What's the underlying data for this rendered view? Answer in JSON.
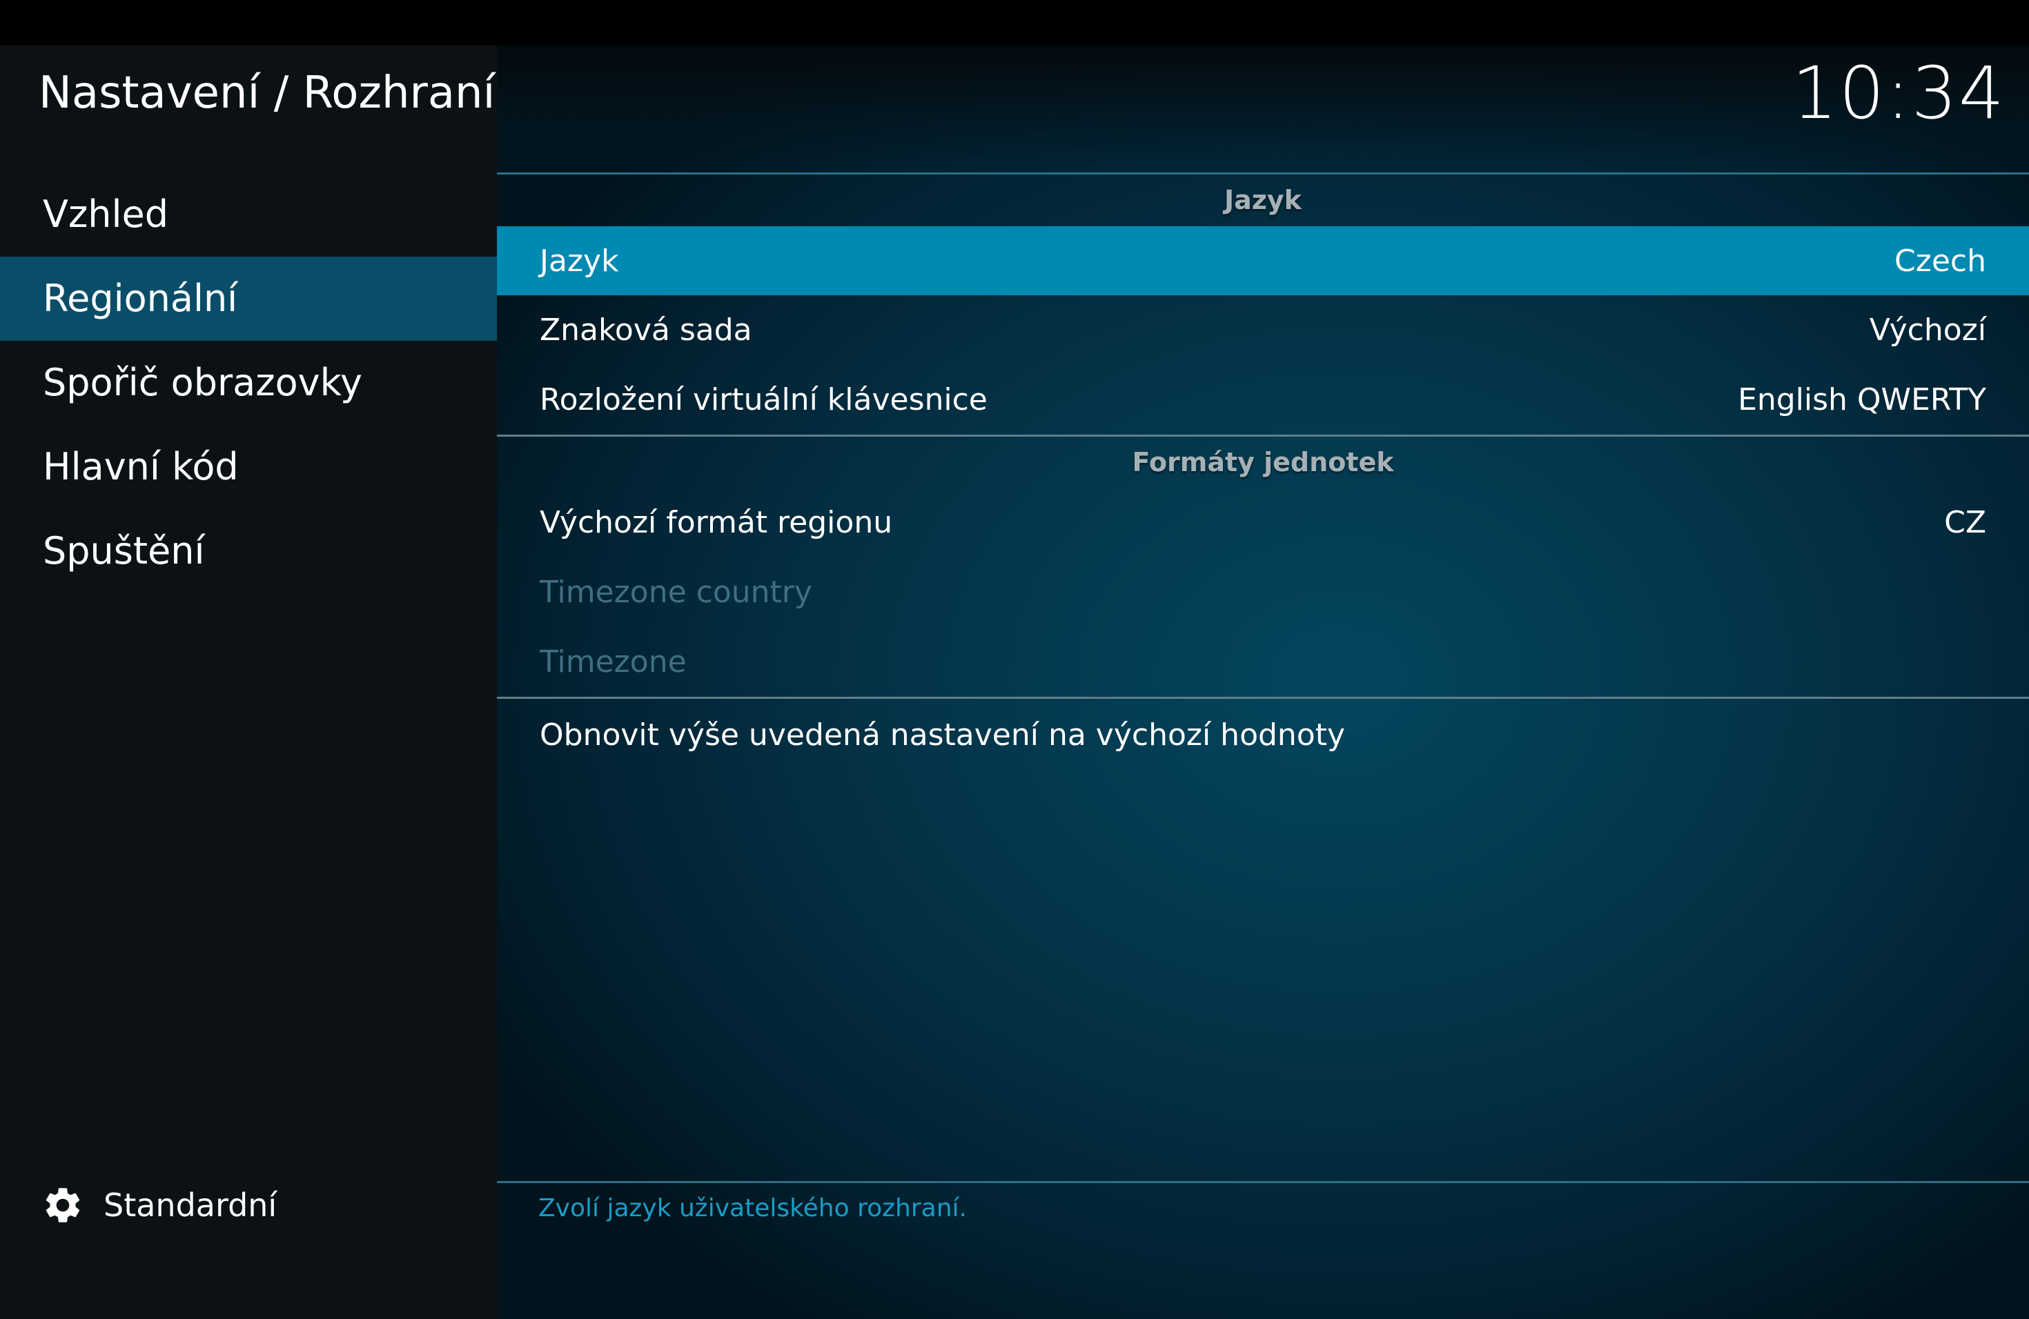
{
  "header": {
    "title": "Nastavení / Rozhraní",
    "clock": "10:34"
  },
  "sidebar": {
    "items": [
      {
        "label": "Vzhled",
        "active": false
      },
      {
        "label": "Regionální",
        "active": true
      },
      {
        "label": "Spořič obrazovky",
        "active": false
      },
      {
        "label": "Hlavní kód",
        "active": false
      },
      {
        "label": "Spuštění",
        "active": false
      }
    ],
    "footer": {
      "icon": "gear-icon",
      "label": "Standardní"
    }
  },
  "main": {
    "sections": [
      {
        "header": "Jazyk",
        "rows": [
          {
            "label": "Jazyk",
            "value": "Czech",
            "focused": true,
            "disabled": false
          },
          {
            "label": "Znaková sada",
            "value": "Výchozí",
            "focused": false,
            "disabled": false
          },
          {
            "label": "Rozložení virtuální klávesnice",
            "value": "English QWERTY",
            "focused": false,
            "disabled": false
          }
        ]
      },
      {
        "header": "Formáty jednotek",
        "rows": [
          {
            "label": "Výchozí formát regionu",
            "value": "CZ",
            "focused": false,
            "disabled": false
          },
          {
            "label": "Timezone country",
            "value": "",
            "focused": false,
            "disabled": true
          },
          {
            "label": "Timezone",
            "value": "",
            "focused": false,
            "disabled": true
          }
        ]
      }
    ],
    "reset_action": "Obnovit výše uvedená nastavení na výchozí hodnoty",
    "help_text": "Zvolí jazyk uživatelského rozhraní."
  },
  "colors": {
    "focus": "#0089b1",
    "sidebar_active": "#0a4d68",
    "help_text": "#1a9cc7"
  }
}
